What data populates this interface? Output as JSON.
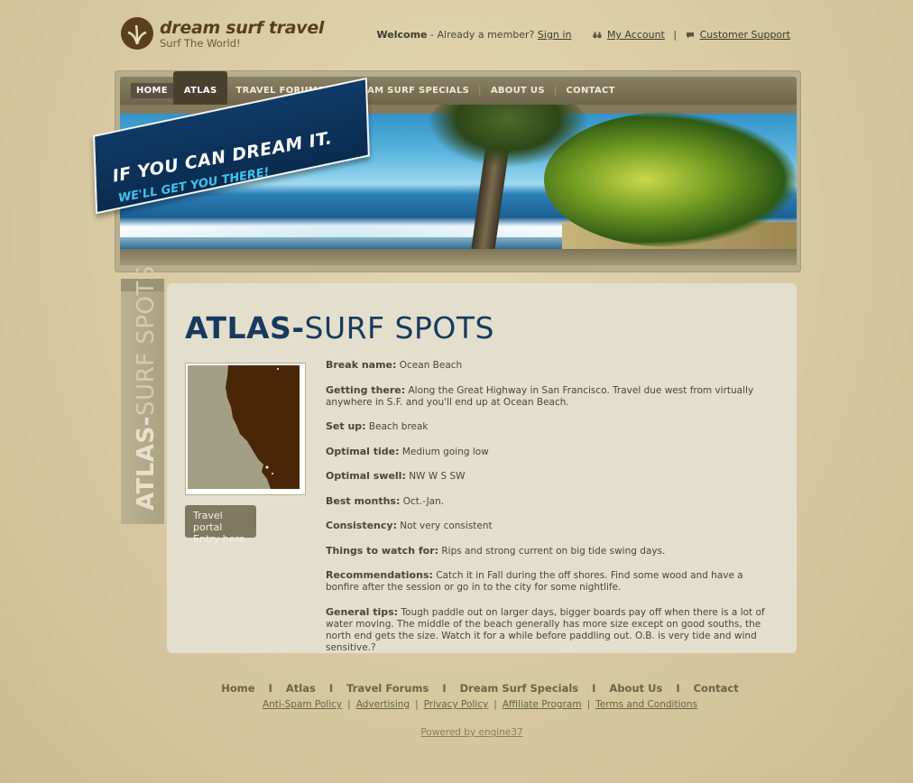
{
  "brand": {
    "name": "dream surf travel",
    "tagline": "Surf The World!"
  },
  "top_links": {
    "welcome": "Welcome",
    "member_prompt": " - Already a member? ",
    "sign_in": "Sign in",
    "my_account": "My Account",
    "separator": "|",
    "customer_support": "Customer Support"
  },
  "nav": {
    "items": [
      "HOME",
      "ATLAS",
      "TRAVEL FORUMS",
      "DREAM SURF SPECIALS",
      "ABOUT US",
      "CONTACT"
    ],
    "separator": "|",
    "active": "ATLAS"
  },
  "banner": {
    "slogan_line1": "IF YOU CAN DREAM IT.",
    "slogan_line2": "WE'LL GET YOU THERE!"
  },
  "side_tab": {
    "label_bold": "ATLAS-",
    "label_thin": "SURF SPOTS"
  },
  "page": {
    "heading_bold": "ATLAS-",
    "heading_thin": "SURF SPOTS",
    "portal_button_line1": "Travel portal",
    "portal_button_line2": "Entry here"
  },
  "details": [
    {
      "label": "Break name:",
      "value": " Ocean Beach"
    },
    {
      "label": "Getting there:",
      "value": " Along the Great Highway in San Francisco. Travel due west from virtually anywhere in S.F. and you'll end up at Ocean Beach."
    },
    {
      "label": "Set up:",
      "value": " Beach break"
    },
    {
      "label": "Optimal tide:",
      "value": " Medium going low"
    },
    {
      "label": "Optimal swell:",
      "value": " NW W S SW"
    },
    {
      "label": "Best months:",
      "value": " Oct.-Jan."
    },
    {
      "label": "Consistency:",
      "value": " Not very consistent"
    },
    {
      "label": "Things to watch for:",
      "value": " Rips and strong current on big tide swing days."
    },
    {
      "label": "Recommendations:",
      "value": " Catch it in Fall during the off shores. Find some wood and have a bonfire after the session or go in to the city for some nightlife."
    },
    {
      "label": "General tips:",
      "value": " Tough paddle out on larger days, bigger boards pay off when there is a lot of water moving. The middle of the beach generally has more size except on good souths, the north end gets the size. Watch it for a while before paddling out. O.B. is very tide and wind sensitive.?"
    }
  ],
  "footer": {
    "nav": [
      "Home",
      "Atlas",
      "Travel Forums",
      "Dream Surf Specials",
      "About Us",
      "Contact"
    ],
    "nav_separator": "I",
    "legal": [
      "Anti-Spam Policy",
      "Advertising",
      "Privacy Policy",
      "Affiliate Program",
      "Terms and Conditions"
    ],
    "legal_separator": "|",
    "powered": "Powered by engine37"
  },
  "colors": {
    "background": "#d9c9a2",
    "heading": "#183a5e",
    "content_bg": "#e4dfcd",
    "nav_bg": "#7a7157",
    "logo_brown": "#5a3f1e"
  }
}
